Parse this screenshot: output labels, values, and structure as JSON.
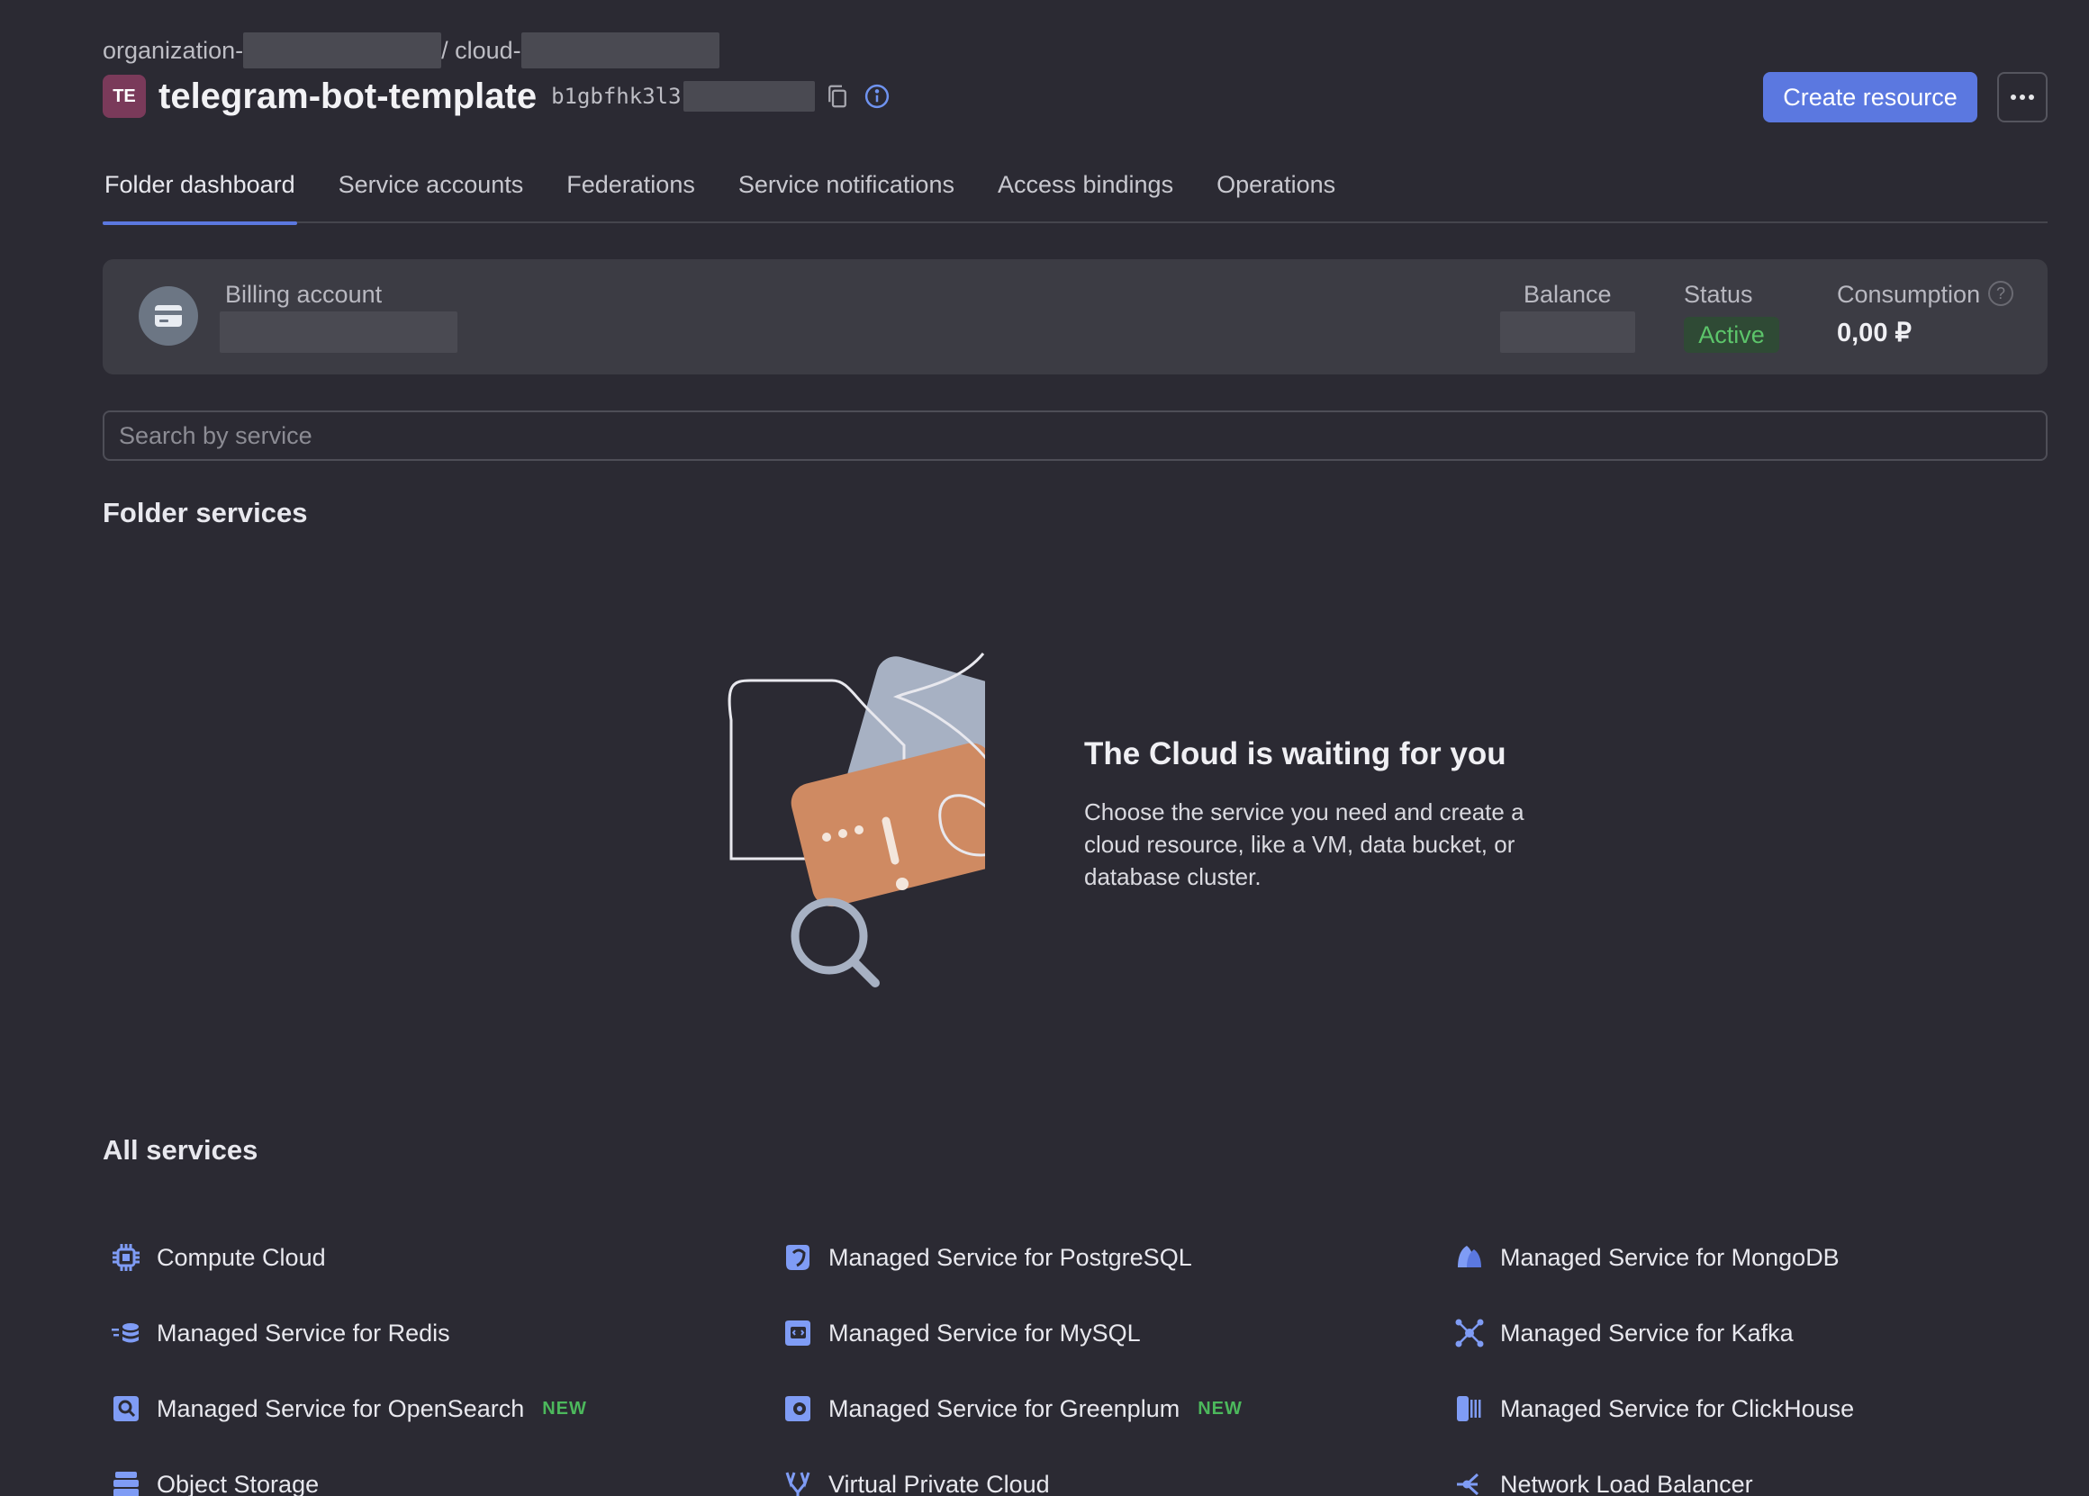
{
  "header": {
    "breadcrumb_org": "organization-",
    "breadcrumb_sep": "/ cloud-",
    "folder_badge": "TE",
    "folder_name": "telegram-bot-template",
    "folder_id": "b1gbfhk3l3",
    "create_button": "Create resource"
  },
  "tabs": [
    {
      "label": "Folder dashboard",
      "active": true
    },
    {
      "label": "Service accounts"
    },
    {
      "label": "Federations"
    },
    {
      "label": "Service notifications"
    },
    {
      "label": "Access bindings"
    },
    {
      "label": "Operations"
    }
  ],
  "billing": {
    "label": "Billing account",
    "balance_label": "Balance",
    "status_label": "Status",
    "status_value": "Active",
    "consumption_label": "Consumption",
    "consumption_value": "0,00 ₽",
    "help": "?"
  },
  "search": {
    "placeholder": "Search by service"
  },
  "folder_services": {
    "title": "Folder services",
    "empty_heading": "The Cloud is waiting for you",
    "empty_text": "Choose the service you need and create a cloud resource, like a VM, data bucket, or database cluster."
  },
  "all_services": {
    "title": "All services",
    "badge_new": "NEW",
    "items": [
      {
        "label": "Compute Cloud",
        "icon": "cpu-icon"
      },
      {
        "label": "Managed Service for PostgreSQL",
        "icon": "postgresql-icon"
      },
      {
        "label": "Managed Service for MongoDB",
        "icon": "mongodb-icon"
      },
      {
        "label": "Managed Service for Redis",
        "icon": "redis-icon"
      },
      {
        "label": "Managed Service for MySQL",
        "icon": "mysql-icon"
      },
      {
        "label": "Managed Service for Kafka",
        "icon": "kafka-icon"
      },
      {
        "label": "Managed Service for OpenSearch",
        "icon": "opensearch-icon",
        "new": true
      },
      {
        "label": "Managed Service for Greenplum",
        "icon": "greenplum-icon",
        "new": true
      },
      {
        "label": "Managed Service for ClickHouse",
        "icon": "clickhouse-icon"
      },
      {
        "label": "Object Storage",
        "icon": "object-storage-icon"
      },
      {
        "label": "Virtual Private Cloud",
        "icon": "vpc-icon"
      },
      {
        "label": "Network Load Balancer",
        "icon": "load-balancer-icon"
      }
    ]
  },
  "colors": {
    "accent": "#5b78e0",
    "background": "#2b2a33",
    "status_active": "#5cc46a",
    "icon": "#7f9cf5"
  }
}
